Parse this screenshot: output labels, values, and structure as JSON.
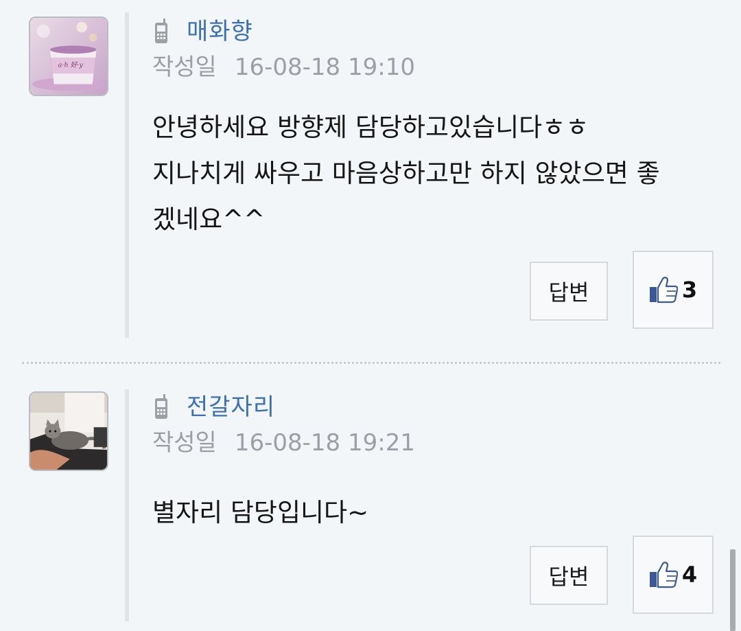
{
  "comments": [
    {
      "author": "매화향",
      "date_label": "작성일",
      "date": "16-08-18 19:10",
      "body_lines": [
        "안녕하세요 방향제 담당하고있습니다ㅎㅎ",
        "지나치게 싸우고 마음상하고만 하지 않았으면 좋",
        "겠네요^^"
      ],
      "reply_label": "답변",
      "likes": "3"
    },
    {
      "author": "전갈자리",
      "date_label": "작성일",
      "date": "16-08-18 19:21",
      "body_lines": [
        "별자리 담당입니다~"
      ],
      "reply_label": "답변",
      "likes": "4"
    }
  ],
  "icons": {
    "device": "mobile-phone-icon",
    "like": "thumbs-up-icon"
  },
  "colors": {
    "author": "#3b6fb6",
    "meta": "#9aa0a6",
    "like_icon": "#3b5998"
  }
}
